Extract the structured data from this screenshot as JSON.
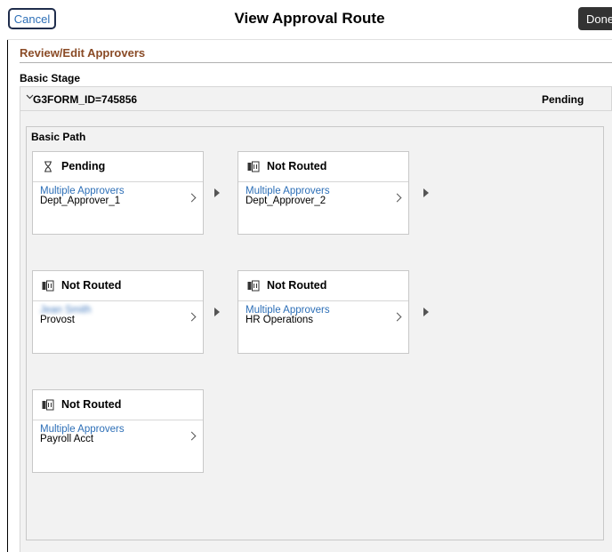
{
  "header": {
    "cancel_label": "Cancel",
    "title": "View Approval Route",
    "done_label": "Done"
  },
  "section": {
    "title": "Review/Edit Approvers"
  },
  "stage": {
    "label": "Basic Stage",
    "id": "G3FORM_ID=745856",
    "status": "Pending"
  },
  "path": {
    "label": "Basic Path",
    "cards": [
      {
        "status": "Pending",
        "status_icon": "hourglass-icon",
        "role": "Multiple Approvers",
        "name": "Dept_Approver_1"
      },
      {
        "status": "Not Routed",
        "status_icon": "not-routed-icon",
        "role": "Multiple Approvers",
        "name": "Dept_Approver_2"
      },
      {
        "status": "Not Routed",
        "status_icon": "not-routed-icon",
        "role": "Jean Smith",
        "name": "Provost"
      },
      {
        "status": "Not Routed",
        "status_icon": "not-routed-icon",
        "role": "Multiple Approvers",
        "name": "HR Operations"
      },
      {
        "status": "Not Routed",
        "status_icon": "not-routed-icon",
        "role": "Multiple Approvers",
        "name": "Payroll Acct"
      }
    ]
  },
  "colors": {
    "link": "#2d6fb7",
    "section_title": "#8a4b26",
    "done_bg": "#333333",
    "panel_bg": "#f2f2f2"
  }
}
